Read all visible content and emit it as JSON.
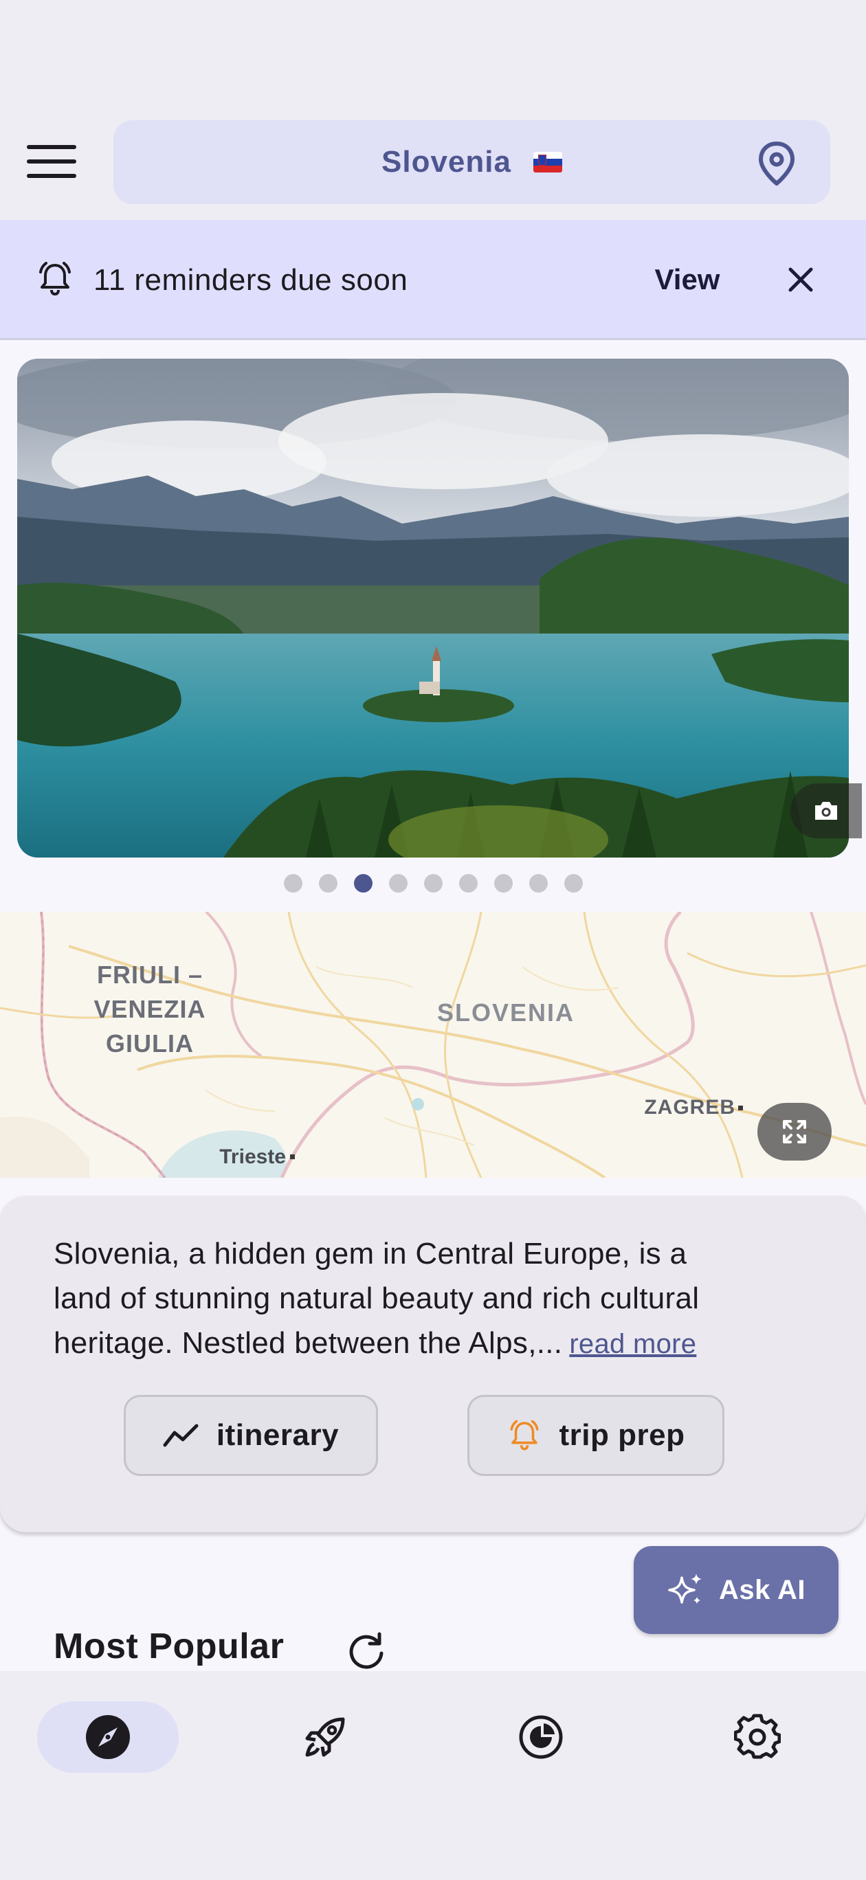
{
  "header": {
    "title": "Slovenia",
    "flag_icon": "slovenia-flag-icon",
    "menu_icon": "hamburger-menu-icon",
    "location_icon": "map-pin-icon"
  },
  "reminder_banner": {
    "text": "11 reminders due soon",
    "view_label": "View",
    "bell_icon": "bell-icon",
    "close_icon": "close-icon"
  },
  "gallery": {
    "total_images": 9,
    "active_index": 2,
    "camera_icon": "camera-icon"
  },
  "map": {
    "labels": {
      "friuli_1": "FRIULI –",
      "friuli_2": "VENEZIA",
      "friuli_3": "GIULIA",
      "country": "SLOVENIA",
      "zagreb": "ZAGREB",
      "trieste": "Trieste"
    },
    "expand_icon": "fullscreen-icon"
  },
  "description": {
    "line1": "Slovenia, a hidden gem in Central Europe, is a",
    "line2": "land of stunning natural beauty and rich cultural",
    "line3": "heritage. Nestled between the Alps,...",
    "read_more": "read more"
  },
  "actions": {
    "itinerary_label": "itinerary",
    "trip_prep_label": "trip prep"
  },
  "ask_ai": {
    "label": "Ask AI",
    "icon": "sparkles-icon"
  },
  "section": {
    "title": "Most Popular",
    "refresh_icon": "refresh-icon"
  },
  "bottom_nav": {
    "items": [
      {
        "icon": "compass-icon",
        "active": true
      },
      {
        "icon": "rocket-icon",
        "active": false
      },
      {
        "icon": "pie-chart-icon",
        "active": false
      },
      {
        "icon": "gear-icon",
        "active": false
      }
    ]
  },
  "colors": {
    "accent": "#4e5690",
    "banner_bg": "#dfdffd",
    "ask_ai_bg": "#6a70a8",
    "trip_prep_icon": "#f08a24"
  }
}
